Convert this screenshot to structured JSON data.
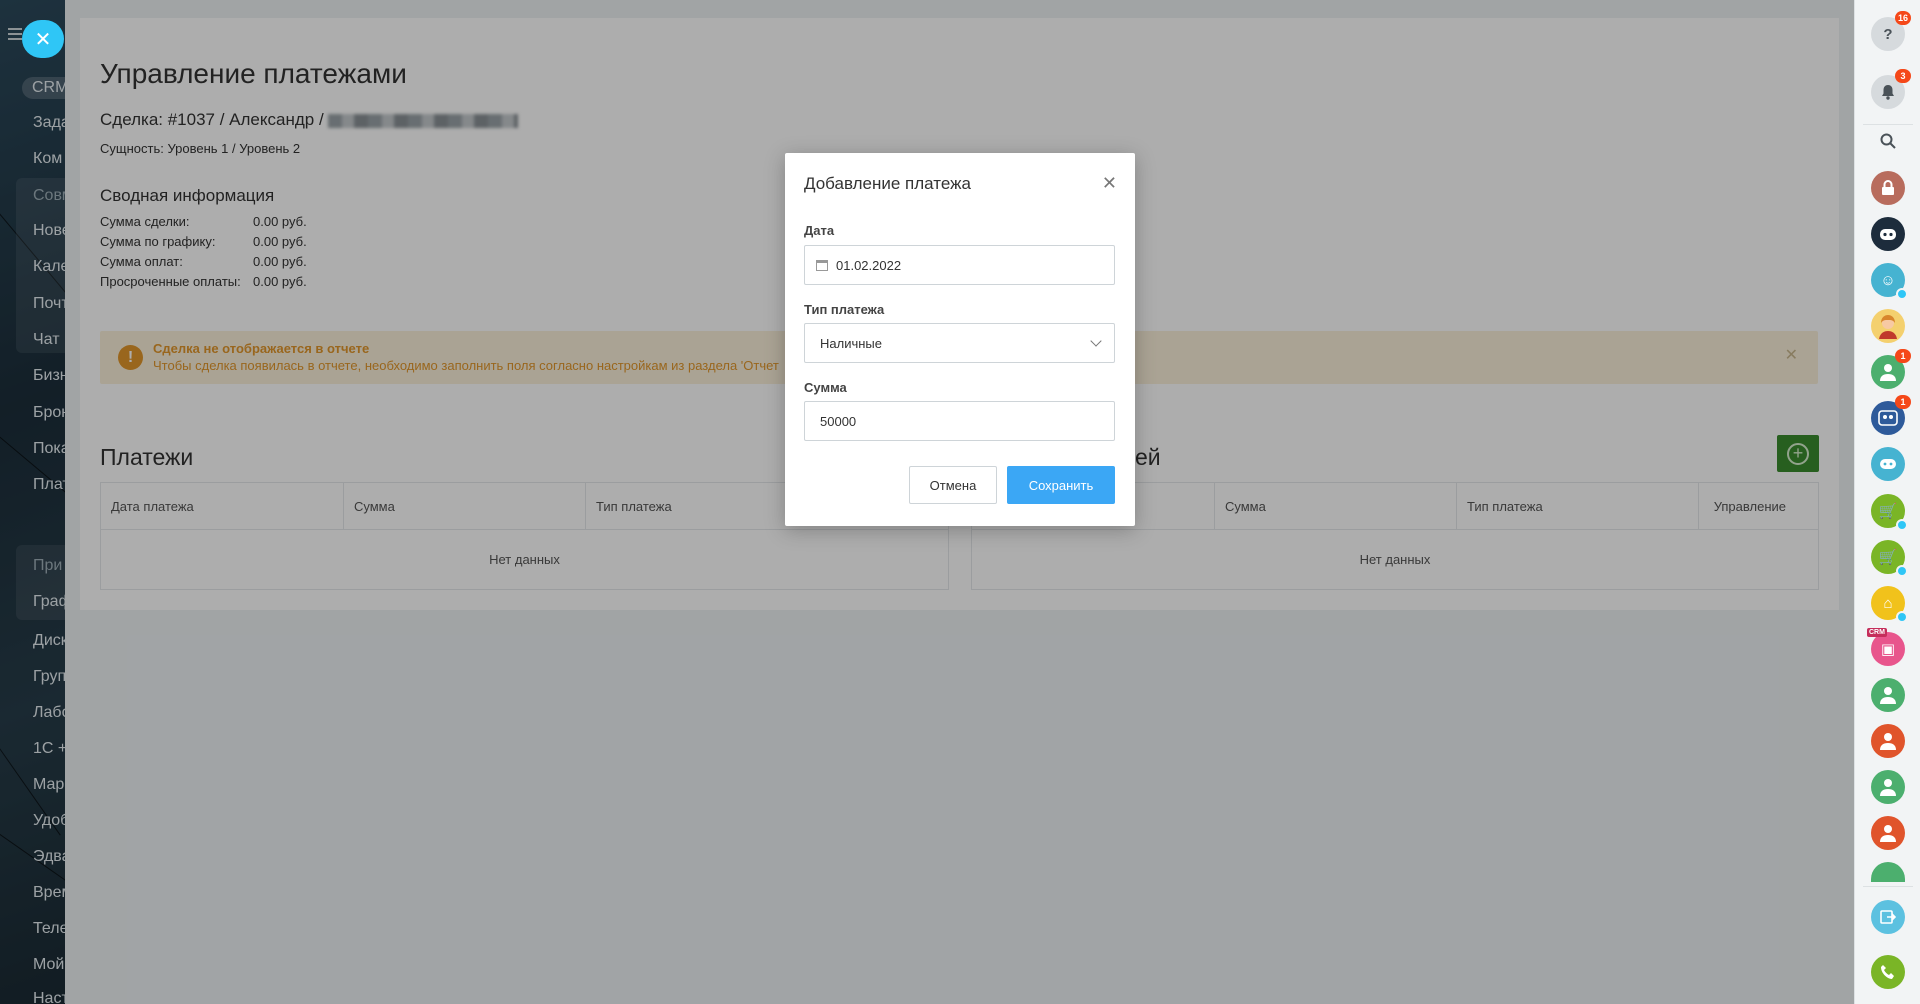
{
  "left_sidebar": {
    "pill": "CRM",
    "items": [
      "Зада",
      "Ком",
      "Совм",
      "Нове",
      "Кале",
      "Почт",
      "Чат",
      "Бизн",
      "Брон",
      "Пока",
      "Плат",
      "При",
      "Граф",
      "Диск",
      "Груп",
      "Лабо",
      "1С +",
      "Мар",
      "Удоб",
      "Эдва",
      "Врем",
      "Теле",
      "Мой",
      "Наст"
    ]
  },
  "page": {
    "title": "Управление платежами",
    "deal_prefix": "Сделка: #1037 / Александр /",
    "entity": "Сущность: Уровень 1 / Уровень 2",
    "summary_title": "Сводная информация",
    "summary": [
      {
        "label": "Сумма сделки:",
        "value": "0.00 руб."
      },
      {
        "label": "Сумма по графику:",
        "value": "0.00 руб."
      },
      {
        "label": "Сумма оплат:",
        "value": "0.00 руб."
      },
      {
        "label": "Просроченные оплаты:",
        "value": "0.00 руб."
      }
    ],
    "warning": {
      "title": "Сделка не отображается в отчете",
      "text": "Чтобы сделка появилась в отчете, необходимо заполнить поля согласно настройкам из раздела 'Отчет"
    },
    "payments": {
      "title": "Платежи",
      "columns": [
        "Дата платежа",
        "Сумма",
        "Тип платежа"
      ],
      "empty": "Нет данных"
    },
    "schedule": {
      "title_visible": "ей",
      "columns": [
        "Сумма",
        "Тип платежа",
        "Управление"
      ],
      "empty": "Нет данных"
    }
  },
  "modal": {
    "title": "Добавление платежа",
    "date_label": "Дата",
    "date_value": "01.02.2022",
    "type_label": "Тип платежа",
    "type_value": "Наличные",
    "sum_label": "Сумма",
    "sum_value": "50000",
    "cancel_label": "Отмена",
    "save_label": "Сохранить"
  },
  "right_sidebar": {
    "help_badge": "16",
    "notifications_badge": "3",
    "contact_badge_1": "1",
    "contact_badge_2": "1",
    "crm_tag": "CRM",
    "colors": {
      "lock_app": "#b86c5d",
      "robot": "#1d2c3c",
      "green": "#4caf6e",
      "blue": "#2e5a9a",
      "teal": "#46b3d1",
      "lime": "#7ab526",
      "yellow": "#f1c21b",
      "pink": "#e8558c",
      "red": "#e0542b"
    }
  }
}
